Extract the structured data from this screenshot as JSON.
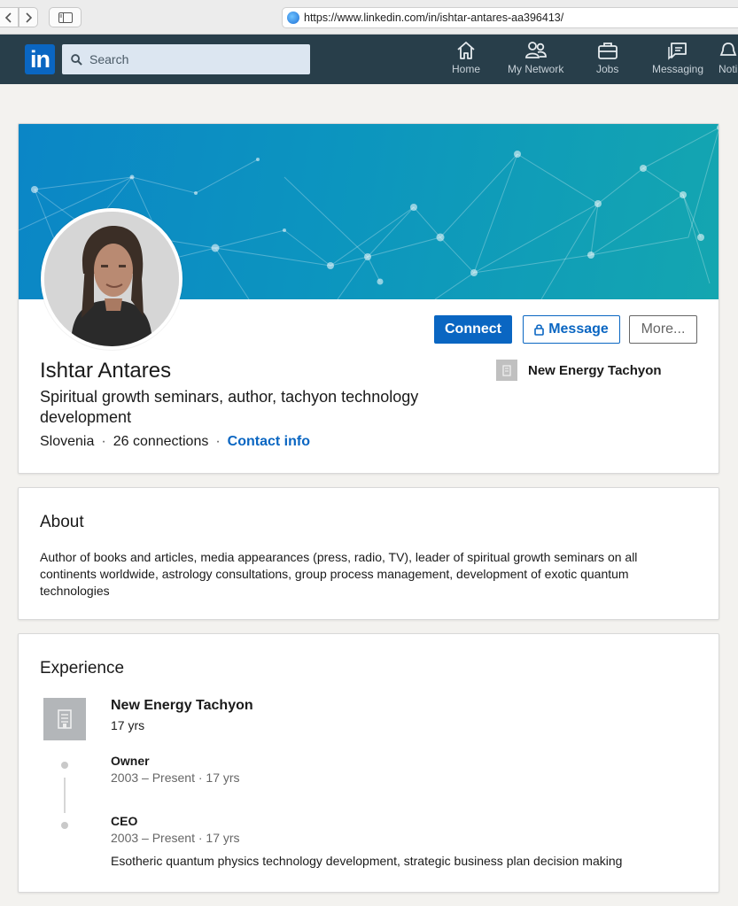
{
  "browser": {
    "url": "https://www.linkedin.com/in/ishtar-antares-aa396413/"
  },
  "header": {
    "logo": "in",
    "search_placeholder": "Search",
    "nav": [
      {
        "label": "Home",
        "icon": "home-icon"
      },
      {
        "label": "My Network",
        "icon": "network-icon"
      },
      {
        "label": "Jobs",
        "icon": "briefcase-icon"
      },
      {
        "label": "Messaging",
        "icon": "messaging-icon"
      },
      {
        "label": "Noti",
        "icon": "bell-icon"
      }
    ]
  },
  "profile": {
    "name": "Ishtar Antares",
    "headline": "Spiritual growth seminars, author, tachyon technology development",
    "location": "Slovenia",
    "connections": "26 connections",
    "contact_label": "Contact info",
    "current_company": "New Energy Tachyon",
    "buttons": {
      "connect": "Connect",
      "message": "Message",
      "more": "More..."
    }
  },
  "about": {
    "title": "About",
    "text": "Author of books and articles, media appearances (press, radio, TV), leader of spiritual growth seminars on all continents worldwide, astrology consultations, group process management, development of exotic quantum technologies"
  },
  "experience": {
    "title": "Experience",
    "company": "New Energy Tachyon",
    "duration": "17 yrs",
    "roles": [
      {
        "title": "Owner",
        "dates": "2003 – Present",
        "duration": "17 yrs"
      },
      {
        "title": "CEO",
        "dates": "2003 – Present",
        "duration": "17 yrs",
        "description": "Esotheric quantum physics technology development, strategic business plan decision making"
      }
    ]
  },
  "colors": {
    "brand": "#0a66c2",
    "header_bg": "#283e4a",
    "banner": "#0c95bf"
  }
}
